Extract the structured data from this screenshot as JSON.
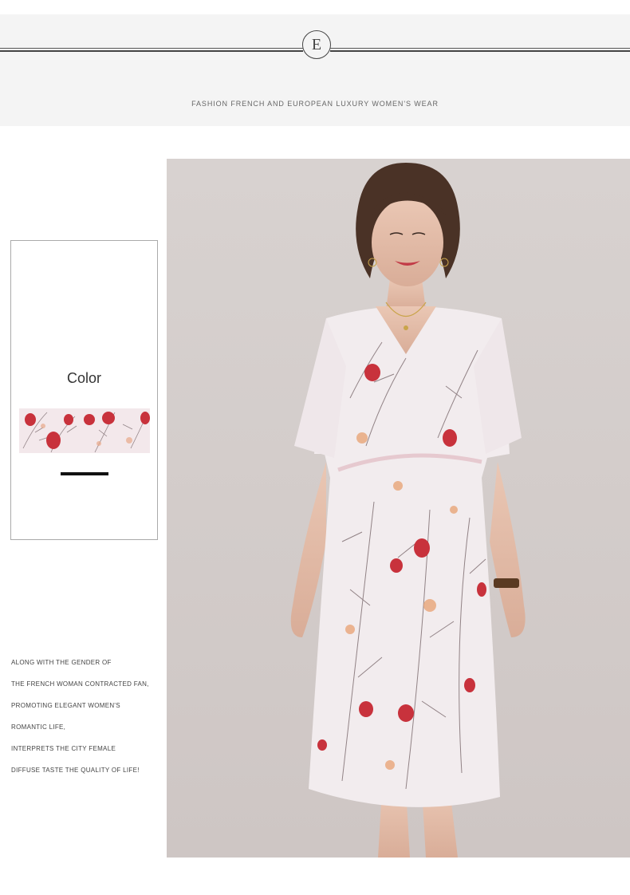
{
  "header": {
    "emblem_letter": "E",
    "tagline": "FASHION FRENCH AND EUROPEAN LUXURY WOMEN'S WEAR"
  },
  "color_selector": {
    "label": "Color",
    "selected_swatch": "floral-print"
  },
  "description": {
    "lines": [
      "ALONG WITH THE GENDER OF",
      "THE FRENCH WOMAN CONTRACTED FAN,",
      "PROMOTING ELEGANT WOMEN'S",
      "ROMANTIC LIFE,",
      "INTERPRETS THE CITY FEMALE",
      "DIFFUSE TASTE THE QUALITY OF LIFE!"
    ]
  },
  "colors": {
    "band_bg": "#f4f4f4",
    "rule": "#444444",
    "accent_red": "#c8323c",
    "dress_base": "#f2ecee"
  }
}
